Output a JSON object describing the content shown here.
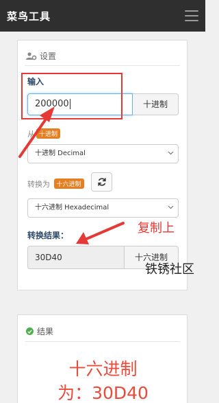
{
  "app": {
    "title": "菜鸟工具"
  },
  "settings": {
    "header": "设置",
    "input_label": "输入",
    "input_value": "200000",
    "input_unit": "十进制",
    "from_label_prefix": "从",
    "from_badge": "十进制",
    "from_select": "十进制 Decimal",
    "to_label": "转换为",
    "to_badge": "十六进制",
    "to_select": "十六进制 Hexadecimal",
    "result_label": "转换结果：",
    "result_value": "30D40",
    "result_unit": "十六进制"
  },
  "result": {
    "header": "结果",
    "line1": "十六进制",
    "line2": "为：30D40"
  },
  "annotations": {
    "copy_note": "复制上",
    "watermark": "铁锈社区"
  },
  "colors": {
    "topbar": "#2f2f2f",
    "accent_badge": "#e67e22",
    "annotation_red": "#e53935",
    "result_red": "#e74c3c",
    "success_green": "#4cae4c"
  },
  "icons": [
    "menu-icon",
    "users-gear-icon",
    "chevron-down-icon",
    "refresh-icon",
    "check-circle-icon"
  ]
}
